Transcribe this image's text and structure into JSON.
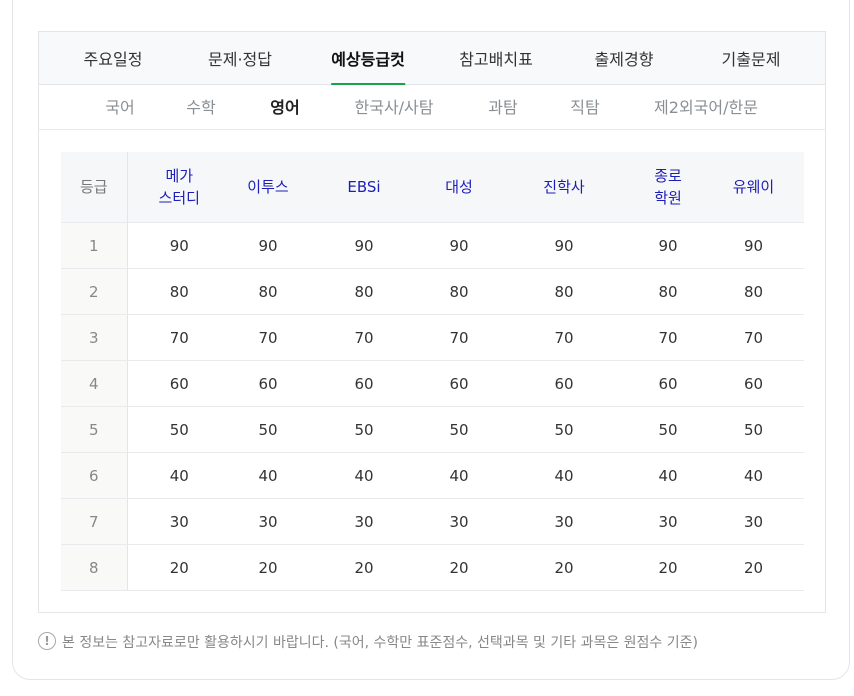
{
  "main_tabs": [
    "주요일정",
    "문제·정답",
    "예상등급컷",
    "참고배치표",
    "출제경향",
    "기출문제"
  ],
  "active_main_tab": "예상등급컷",
  "sub_tabs": [
    "국어",
    "수학",
    "영어",
    "한국사/사탐",
    "과탐",
    "직탐",
    "제2외국어/한문"
  ],
  "active_sub_tab": "영어",
  "table": {
    "grade_header": "등급",
    "providers": [
      "메가\n스터디",
      "이투스",
      "EBSi",
      "대성",
      "진학사",
      "종로\n학원",
      "유웨이"
    ],
    "rows": [
      {
        "grade": "1",
        "values": [
          "90",
          "90",
          "90",
          "90",
          "90",
          "90",
          "90"
        ]
      },
      {
        "grade": "2",
        "values": [
          "80",
          "80",
          "80",
          "80",
          "80",
          "80",
          "80"
        ]
      },
      {
        "grade": "3",
        "values": [
          "70",
          "70",
          "70",
          "70",
          "70",
          "70",
          "70"
        ]
      },
      {
        "grade": "4",
        "values": [
          "60",
          "60",
          "60",
          "60",
          "60",
          "60",
          "60"
        ]
      },
      {
        "grade": "5",
        "values": [
          "50",
          "50",
          "50",
          "50",
          "50",
          "50",
          "50"
        ]
      },
      {
        "grade": "6",
        "values": [
          "40",
          "40",
          "40",
          "40",
          "40",
          "40",
          "40"
        ]
      },
      {
        "grade": "7",
        "values": [
          "30",
          "30",
          "30",
          "30",
          "30",
          "30",
          "30"
        ]
      },
      {
        "grade": "8",
        "values": [
          "20",
          "20",
          "20",
          "20",
          "20",
          "20",
          "20"
        ]
      }
    ]
  },
  "notice": {
    "icon": "exclamation-circle-icon",
    "text": "본 정보는 참고자료로만 활용하시기 바랍니다. (국어, 수학만 표준점수, 선택과목 및 기타 과목은 원점수 기준)"
  },
  "colors": {
    "active_tab_underline": "#1aa34a",
    "provider_header_text": "#1d1db8"
  }
}
